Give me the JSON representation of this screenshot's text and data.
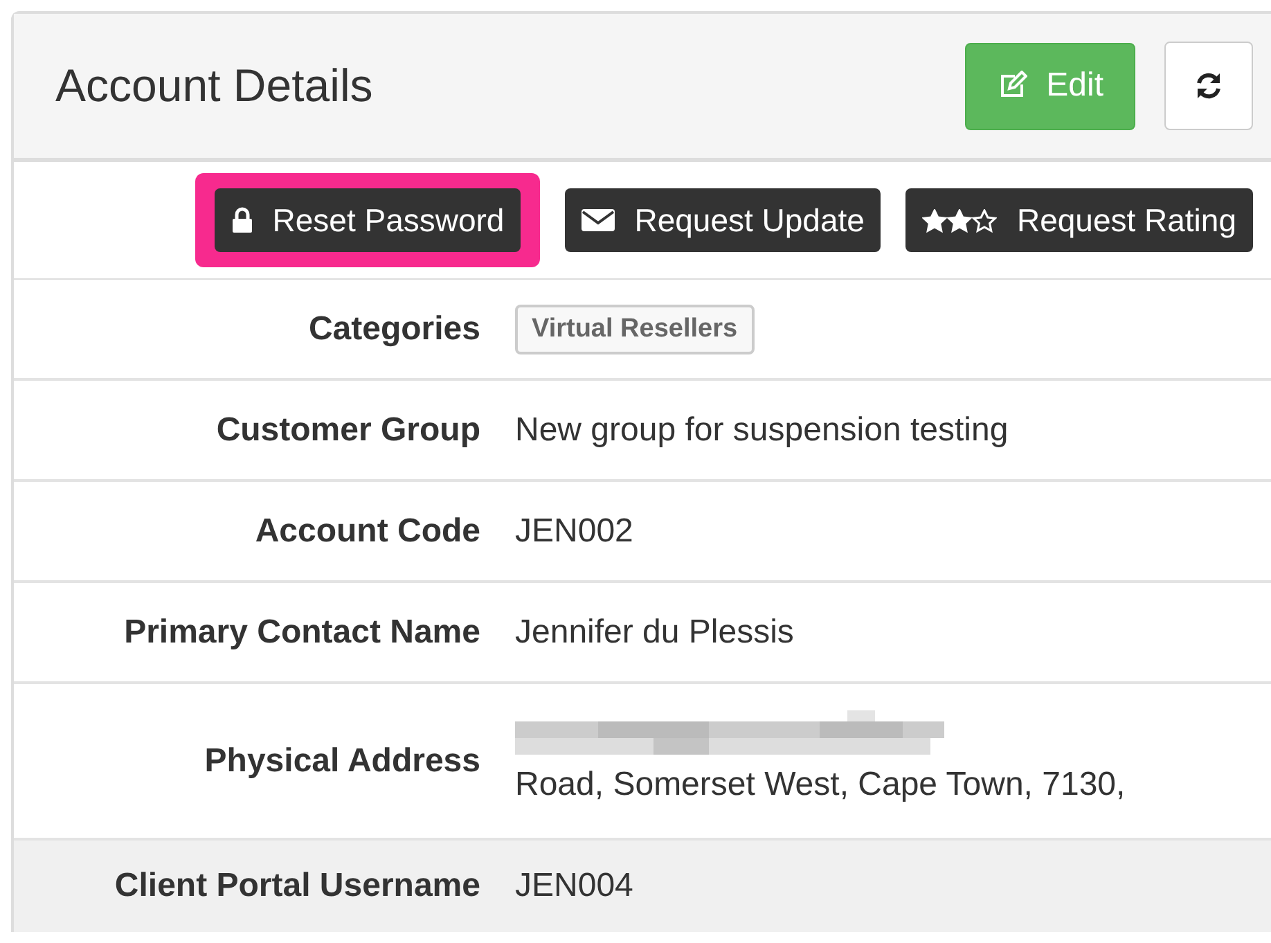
{
  "panel": {
    "title": "Account Details",
    "buttons": [
      {
        "kind": "edit",
        "label": "Edit"
      },
      {
        "kind": "refresh"
      }
    ]
  },
  "actions": [
    {
      "kind": "lock",
      "label": "Reset Password",
      "highlighted": true
    },
    {
      "kind": "envelope",
      "label": "Request Update",
      "highlighted": false
    },
    {
      "kind": "stars",
      "label": "Request Rating",
      "highlighted": false,
      "stars": 2
    }
  ],
  "fields": [
    {
      "label": "Categories",
      "kind": "tags",
      "tags": [
        "Virtual Resellers"
      ],
      "hovered": false
    },
    {
      "label": "Customer Group",
      "kind": "text",
      "value": "New group for suspension testing",
      "hovered": false
    },
    {
      "label": "Account Code",
      "kind": "text",
      "value": "JEN002",
      "hovered": false
    },
    {
      "label": "Primary Contact Name",
      "kind": "text",
      "value": "Jennifer du Plessis",
      "hovered": false
    },
    {
      "label": "Physical Address",
      "kind": "redacted",
      "value": "Road, Somerset West, Cape Town, 7130,",
      "hovered": false
    },
    {
      "label": "Client Portal Username",
      "kind": "text",
      "value": "JEN004",
      "hovered": true
    }
  ]
}
